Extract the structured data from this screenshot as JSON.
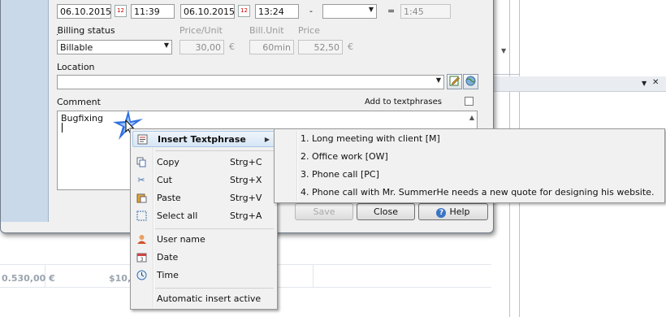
{
  "times": {
    "start_date": "06.10.2015",
    "start_time": "11:39",
    "end_date": "06.10.2015",
    "end_time": "13:24",
    "minus": "-",
    "break_value": "",
    "equals": "=",
    "duration": "1:45"
  },
  "billing": {
    "status_label": "Billing status",
    "status_value": "Billable",
    "price_unit_label": "Price/Unit",
    "price_unit_value": "30,00",
    "currency1": "€",
    "bill_unit_label": "Bill.Unit",
    "bill_unit_value": "60min",
    "price_label": "Price",
    "price_value": "52,50",
    "currency2": "€"
  },
  "location": {
    "label": "Location",
    "value": ""
  },
  "comment": {
    "label": "Comment",
    "add_to_textphrases": "Add to textphrases",
    "text": "Bugfixing"
  },
  "buttons": {
    "save": "Save",
    "close": "Close",
    "help": "Help"
  },
  "context_menu": {
    "insert_textphrase": "Insert Textphrase",
    "copy": "Copy",
    "copy_shortcut": "Strg+C",
    "cut": "Cut",
    "cut_shortcut": "Strg+X",
    "paste": "Paste",
    "paste_shortcut": "Strg+V",
    "select_all": "Select all",
    "select_all_shortcut": "Strg+A",
    "user_name": "User name",
    "date": "Date",
    "time": "Time",
    "automatic_insert": "Automatic insert active"
  },
  "textphrases": [
    "1. Long meeting with client [M]",
    "2. Office work [OW]",
    "3. Phone call [PC]",
    "4. Phone call with Mr. SummerHe needs a new quote for designing his website."
  ],
  "background": {
    "amount1": "0.530,00 €",
    "amount2": "$10,"
  },
  "icons": {
    "calendar": "calendar-icon",
    "edit": "edit-pencil-icon",
    "globe": "globe-icon",
    "help": "help-icon"
  }
}
